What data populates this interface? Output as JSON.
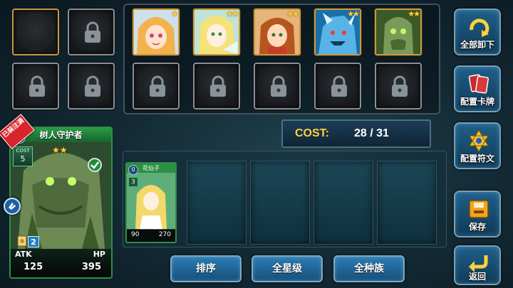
{
  "side_buttons": {
    "unload_all": "全部卸下",
    "config_cards": "配置卡牌",
    "config_runes": "配置符文",
    "save": "保存",
    "back": "返回"
  },
  "cost": {
    "label": "COST:",
    "value": "28 / 31"
  },
  "bottom_buttons": {
    "sort": "排序",
    "all_stars": "全星级",
    "all_races": "全种族"
  },
  "featured_card": {
    "ribbon": "已装注满",
    "name": "树人守护者",
    "level": "0",
    "cost_label": "COST",
    "cost": "5",
    "stars": "★★",
    "badge": "2",
    "atk_label": "ATK",
    "hp_label": "HP",
    "atk": "125",
    "hp": "395"
  },
  "deck_card": {
    "name": "花仙子",
    "level": "0",
    "cost": "3",
    "atk": "90",
    "hp": "270"
  },
  "hero_stars": [
    "★",
    "★★",
    "★★",
    "★★",
    "★★"
  ],
  "colors": {
    "gold_frame": "#c99b43",
    "green_frame": "#2f8f45",
    "cost_text": "#ffd23a",
    "button_blue": "#2b7cb2"
  }
}
